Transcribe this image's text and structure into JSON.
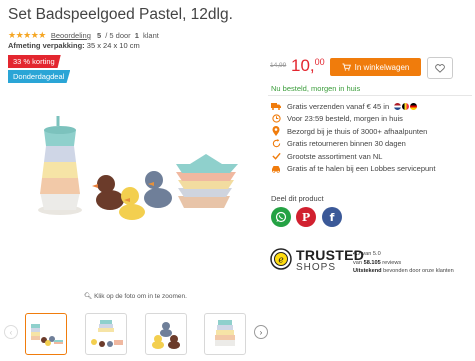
{
  "product": {
    "title": "Set Badspeelgoed Pastel, 12dlg.",
    "rating": {
      "stars": "★★★★★",
      "reviews_link": "Beoordeling",
      "score": "5",
      "score_suffix": " / 5 door ",
      "count": "1",
      "count_suffix": " klant"
    },
    "packaging_label": "Afmeting verpakking:",
    "packaging_value": " 35 x 24 x 10 cm",
    "badges": {
      "discount": "33 % korting",
      "deal": "Donderdagdeal"
    }
  },
  "buybox": {
    "old_price": "14,99",
    "price_main": "10,",
    "price_cents": "00",
    "cart_label": "In winkelwagen",
    "stock_text": "Nu besteld, morgen in huis"
  },
  "usps": [
    {
      "icon": "truck-icon",
      "text": "Gratis verzenden vanaf € 45 in "
    },
    {
      "icon": "clock-icon",
      "text": "Voor 23:59 besteld, morgen in huis"
    },
    {
      "icon": "location-pin-icon",
      "text": "Bezorgd bij je thuis of 3000+ afhaalpunten"
    },
    {
      "icon": "return-icon",
      "text": "Gratis retourneren binnen 30 dagen"
    },
    {
      "icon": "checkmark-icon",
      "text": "Grootste assortiment van NL"
    },
    {
      "icon": "car-icon",
      "text": "Gratis af te halen bij een Lobbes servicepunt"
    }
  ],
  "flags": [
    "nl-flag-icon",
    "be-flag-icon",
    "de-flag-icon"
  ],
  "share": {
    "title": "Deel dit product",
    "networks": [
      "whatsapp-icon",
      "pinterest-icon",
      "facebook-icon"
    ]
  },
  "trusted_shops": {
    "brand": "TRUSTED",
    "shops": "SHOPS",
    "score": "4.7",
    "score_suffix": " van 5.0",
    "reviews_prefix": "van ",
    "reviews_count": "58.105",
    "reviews_suffix": " reviews",
    "verdict": "Uitstekend",
    "verdict_suffix": " bevonden door onze klanten"
  },
  "gallery": {
    "zoom_hint": "Klik op de foto om in te zoomen.",
    "thumbnail_count": 4,
    "prev_icon": "chevron-left-icon",
    "next_icon": "chevron-right-icon"
  },
  "colors": {
    "accent_orange": "#f07c0c",
    "discount_red": "#e3262f",
    "deal_blue": "#2aa5d6",
    "stock_green": "#3a9d3a",
    "whatsapp": "#25a244",
    "pinterest": "#d1202f",
    "facebook": "#3b5998"
  }
}
